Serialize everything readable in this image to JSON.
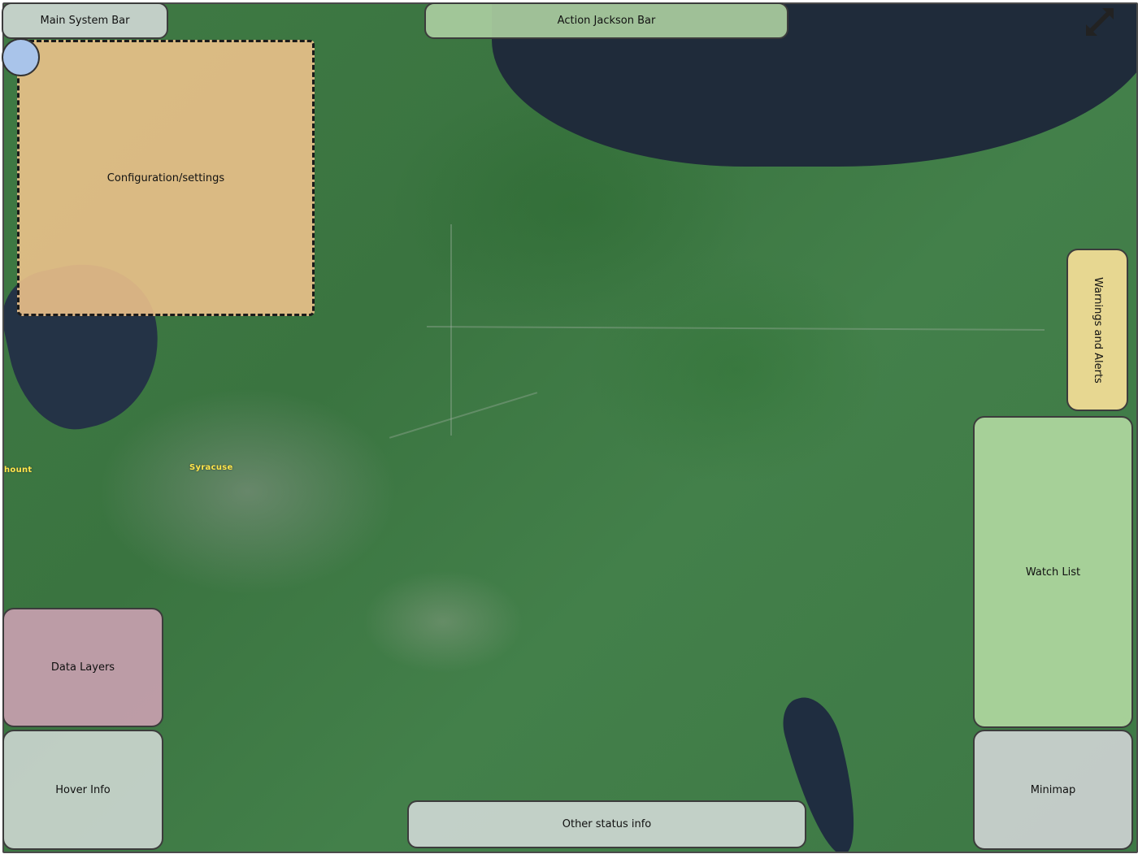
{
  "panels": {
    "main_system_bar": "Main System Bar",
    "action_bar": "Action Jackson Bar",
    "config": "Configuration/settings",
    "warnings": "Warnings and Alerts",
    "watch_list": "Watch List",
    "data_layers": "Data Layers",
    "hover_info": "Hover Info",
    "other_status": "Other status info",
    "minimap": "Minimap"
  },
  "map": {
    "labels": {
      "syracuse": "Syracuse",
      "left_edge": "hount"
    }
  },
  "icons": {
    "expand": "expand-arrows-icon"
  },
  "colors": {
    "system_bar": "#cdd7d2",
    "action_bar": "#aacda0",
    "config": "#f0c48c",
    "warnings": "#f0dc96",
    "watch_list": "#afd7a0",
    "data_layers": "#c8a0af",
    "hover_info": "#cdd7d2",
    "other_status": "#cdd7d2",
    "minimap": "#cdd2d2",
    "handle": "#a9c4ea"
  }
}
